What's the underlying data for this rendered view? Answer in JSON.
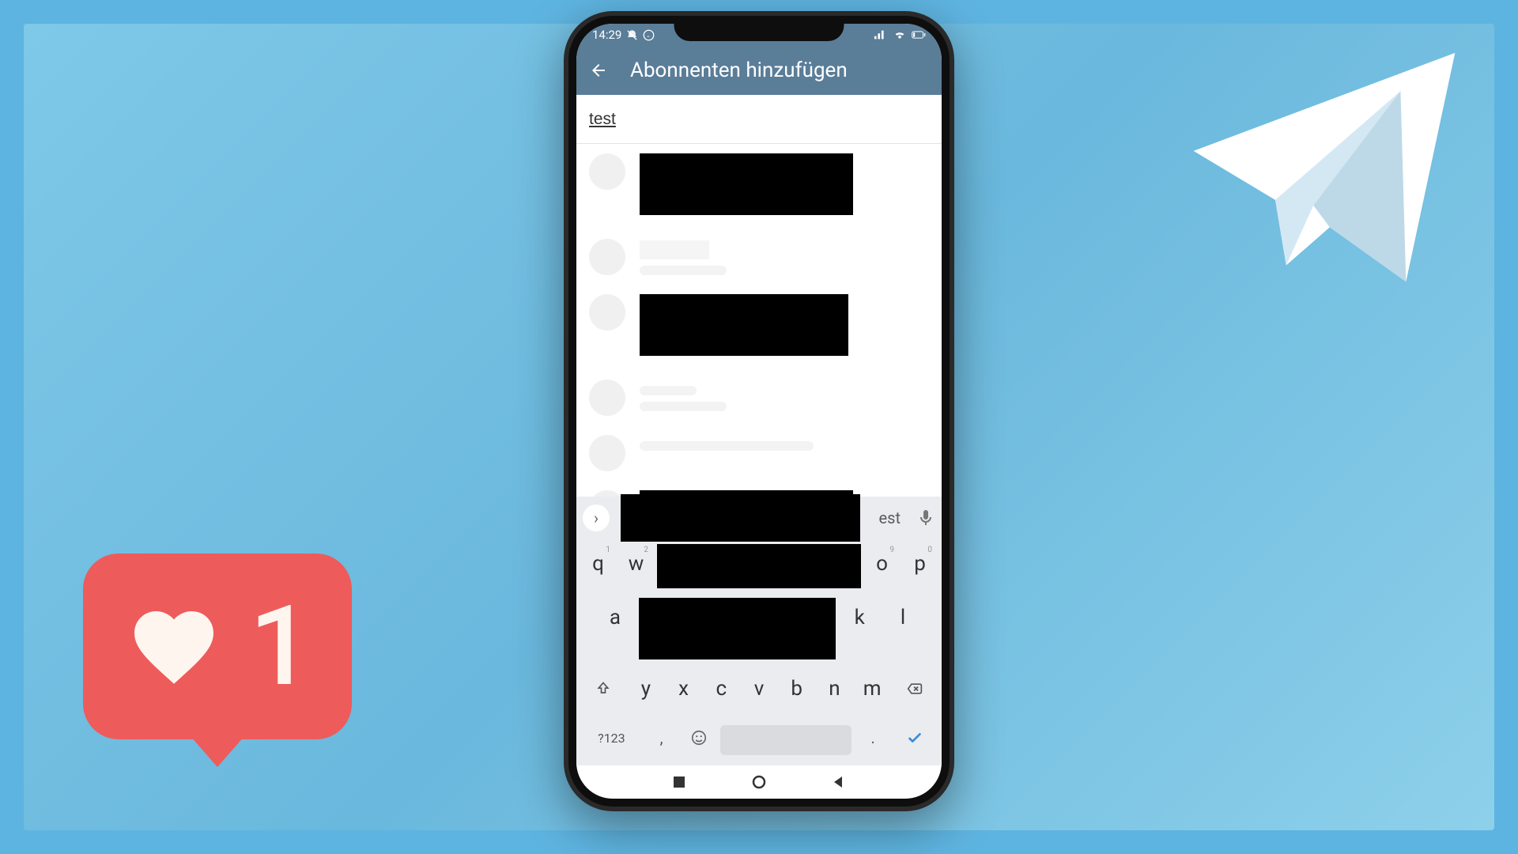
{
  "status": {
    "time": "14:29"
  },
  "header": {
    "title": "Abonnenten hinzufügen"
  },
  "search": {
    "value": "test"
  },
  "keyboard": {
    "suggestion_text": "est",
    "row1": [
      "q",
      "w",
      "",
      "",
      "",
      "",
      "",
      "",
      "o",
      "p"
    ],
    "row1_nums": [
      "1",
      "2",
      "",
      "",
      "",
      "",
      "",
      "",
      "9",
      "0"
    ],
    "row2": [
      "a",
      "",
      "",
      "",
      "",
      "",
      "",
      "k",
      "l"
    ],
    "row3": [
      "y",
      "x",
      "c",
      "v",
      "b",
      "n",
      "m"
    ],
    "num_label": "?123",
    "comma": ",",
    "period": "."
  },
  "like": {
    "count": "1"
  }
}
